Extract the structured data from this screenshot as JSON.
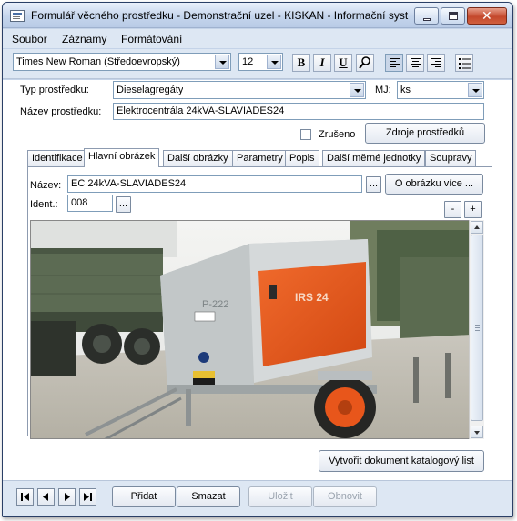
{
  "window": {
    "title": "Formulář věcného prostředku - Demonstrační uzel - KISKAN - Informační syst..."
  },
  "menu": {
    "items": [
      "Soubor",
      "Záznamy",
      "Formátování"
    ]
  },
  "toolbar": {
    "font_name": "Times New Roman (Středoevropský)",
    "font_size": "12",
    "bold_label": "B",
    "italic_label": "I",
    "underline_label": "U"
  },
  "form": {
    "typ_label": "Typ prostředku:",
    "typ_value": "Dieselagregáty",
    "mj_label": "MJ:",
    "mj_value": "ks",
    "nazev_label": "Název prostředku:",
    "nazev_value": "Elektrocentrála 24kVA-SLAVIADES24",
    "zruseno_label": "Zrušeno",
    "zruseno_checked": false,
    "zdroje_button": "Zdroje prostředků"
  },
  "tabs": [
    {
      "label": "Identifikace",
      "active": false
    },
    {
      "label": "Hlavní obrázek",
      "active": true
    },
    {
      "label": "Další obrázky",
      "active": false
    },
    {
      "label": "Parametry",
      "active": false
    },
    {
      "label": "Popis",
      "active": false
    },
    {
      "label": "Další měrné jednotky",
      "active": false
    },
    {
      "label": "Soupravy",
      "active": false
    }
  ],
  "image_tab": {
    "nazev_label": "Název:",
    "nazev_value": "EC 24kVA-SLAVIADES24",
    "ident_label": "Ident.:",
    "ident_value": "008",
    "ellipsis": "...",
    "info_button": "O obrázku více ...",
    "zoom_out": "-",
    "zoom_in": "+",
    "photo_plate_text": "P-222",
    "photo_brand_text": "IRS 24"
  },
  "actions": {
    "catalog_button": "Vytvořit dokument katalogový list"
  },
  "record_bar": {
    "add": "Přidat",
    "delete": "Smazat",
    "save": "Uložit",
    "refresh": "Obnovit"
  }
}
